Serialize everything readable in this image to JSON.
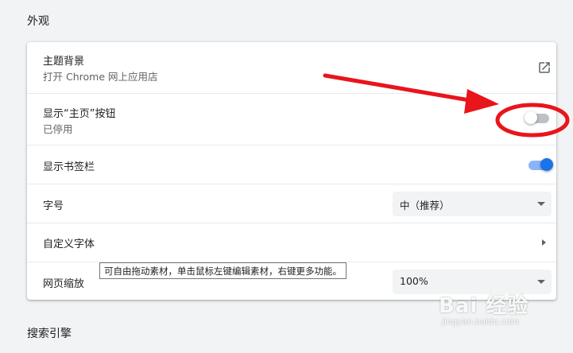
{
  "sections": {
    "appearance_title": "外观",
    "search_engine_title": "搜索引擎"
  },
  "rows": {
    "theme": {
      "label": "主题背景",
      "sub": "打开 Chrome 网上应用店",
      "icon": "open-in-new-icon"
    },
    "home_button": {
      "label": "显示“主页”按钮",
      "sub": "已停用",
      "enabled": false
    },
    "bookmarks_bar": {
      "label": "显示书签栏",
      "enabled": true
    },
    "font_size": {
      "label": "字号",
      "value": "中（推荐）"
    },
    "custom_fonts": {
      "label": "自定义字体"
    },
    "page_zoom": {
      "label": "网页缩放",
      "value": "100%"
    }
  },
  "tooltip": {
    "text": "可自由拖动素材，单击鼠标左键编辑素材，右键更多功能。"
  },
  "annotation": {
    "color": "#e8151b"
  },
  "watermark": {
    "logo": "Bai 经验",
    "url": "jingyan.baidu.com"
  },
  "colors": {
    "accent": "#1a73e8",
    "accent_light": "#8ab4f8",
    "toggle_off": "#bdc1c6"
  }
}
